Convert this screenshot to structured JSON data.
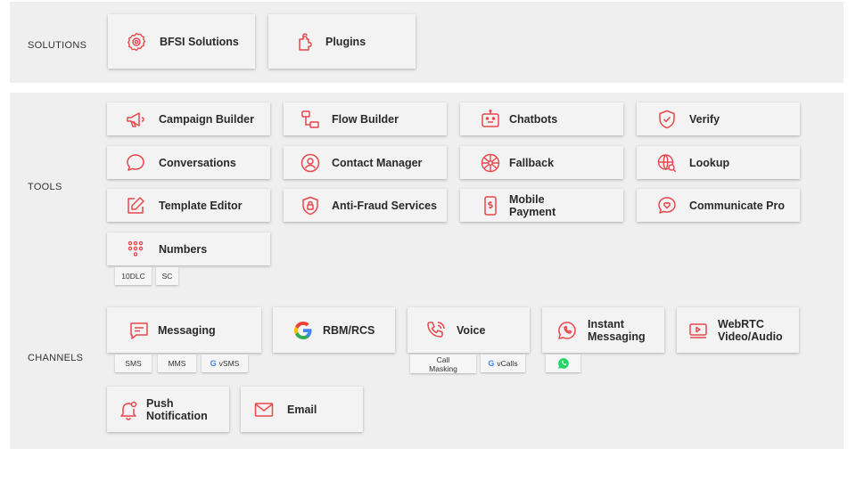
{
  "colors": {
    "accent": "#e8474d",
    "band": "#efefef",
    "card": "#f3f3f3"
  },
  "solutions": {
    "label": "SOLUTIONS",
    "items": [
      {
        "label": "BFSI Solutions",
        "icon": "gear-icon"
      },
      {
        "label": "Plugins",
        "icon": "puzzle-icon"
      }
    ]
  },
  "tools": {
    "label": "TOOLS",
    "items": [
      {
        "label": "Campaign Builder",
        "icon": "megaphone-icon"
      },
      {
        "label": "Flow Builder",
        "icon": "flow-icon"
      },
      {
        "label": "Chatbots",
        "icon": "robot-icon"
      },
      {
        "label": "Verify",
        "icon": "shield-check-icon"
      },
      {
        "label": "Conversations",
        "icon": "chat-bubble-icon"
      },
      {
        "label": "Contact Manager",
        "icon": "person-circle-icon"
      },
      {
        "label": "Fallback",
        "icon": "network-globe-icon"
      },
      {
        "label": "Lookup",
        "icon": "globe-search-icon"
      },
      {
        "label": "Template Editor",
        "icon": "edit-icon"
      },
      {
        "label": "Anti-Fraud Services",
        "icon": "shield-lock-icon"
      },
      {
        "label": "Mobile Payment",
        "line1": "Mobile",
        "line2": "Payment",
        "icon": "mobile-dollar-icon"
      },
      {
        "label": "Communicate Pro",
        "icon": "chat-heart-icon"
      },
      {
        "label": "Numbers",
        "icon": "keypad-icon"
      }
    ],
    "number_chips": [
      "10DLC",
      "SC"
    ]
  },
  "channels": {
    "label": "CHANNELS",
    "items": [
      {
        "label": "Messaging",
        "icon": "message-icon"
      },
      {
        "label": "RBM/RCS",
        "icon": "google-icon"
      },
      {
        "label": "Voice",
        "icon": "phone-icon"
      },
      {
        "label": "Instant Messaging",
        "line1": "Instant",
        "line2": "Messaging",
        "icon": "whatsapp-outline-icon"
      },
      {
        "label": "WebRTC Video/Audio",
        "line1": "WebRTC",
        "line2": "Video/Audio",
        "icon": "video-screen-icon"
      },
      {
        "label": "Push Notification",
        "line1": "Push",
        "line2": "Notification",
        "icon": "bell-icon"
      },
      {
        "label": "Email",
        "icon": "envelope-icon"
      }
    ],
    "messaging_chips": [
      "SMS",
      "MMS",
      "vSMS"
    ],
    "voice_chips": [
      "Call Masking",
      "vCalls"
    ],
    "voice_chip_call_masking": {
      "line1": "Call",
      "line2": "Masking"
    }
  }
}
